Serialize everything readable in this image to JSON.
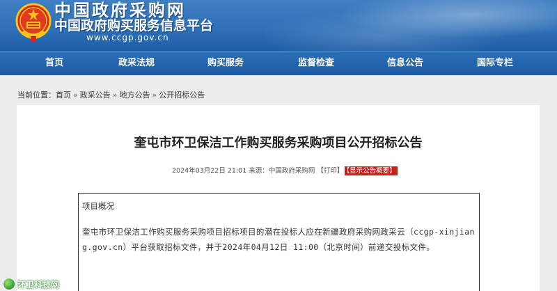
{
  "header": {
    "title": "中国政府采购网",
    "subtitle": "中国政府购买服务信息平台",
    "url": "www.ccgp.gov.cn"
  },
  "nav": {
    "items": [
      {
        "label": "首页"
      },
      {
        "label": "政采法规"
      },
      {
        "label": "购买服务"
      },
      {
        "label": "监督检查"
      },
      {
        "label": "信息公告"
      },
      {
        "label": "国际专栏"
      }
    ]
  },
  "breadcrumb": {
    "prefix": "当前位置：",
    "items": [
      "首页",
      "政采公告",
      "地方公告",
      "公开招标公告"
    ],
    "separator": "»"
  },
  "article": {
    "title": "奎屯市环卫保洁工作购买服务采购项目公开招标公告",
    "datetime": "2024年03月22日 21:01",
    "source_label": "来源：",
    "source": "中国政府采购网",
    "print_label": "【打印】",
    "summary_label": "【显示公告概要】",
    "section_heading": "项目概况",
    "body": "奎屯市环卫保洁工作购买服务采购项目招标项目的潜在投标人应在新疆政府采购网政采云（ccgp-xinjiang.gov.cn）平台获取招标文件，并于2024年04月12日 11:00（北京时间）前递交投标文件。"
  },
  "watermark": {
    "text": "环卫科技网"
  },
  "colors": {
    "header_blue": "#2f70b8",
    "nav_blue": "#1b5aa2",
    "summary_red": "#c8201c",
    "page_bg": "#ececec"
  }
}
